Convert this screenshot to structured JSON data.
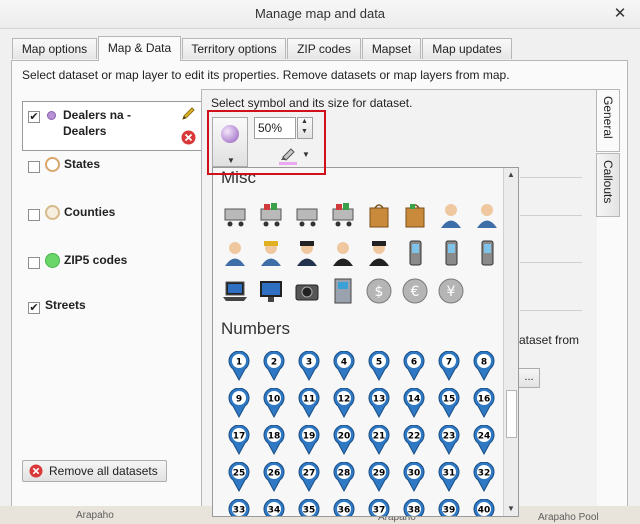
{
  "window": {
    "title": "Manage map and data"
  },
  "tabs": [
    "Map options",
    "Map & Data",
    "Territory options",
    "ZIP codes",
    "Mapset",
    "Map updates"
  ],
  "active_tab": "Map & Data",
  "instruction": "Select dataset or map layer to edit its properties. Remove datasets or map layers from map.",
  "datasets": [
    {
      "label_line1": "Dealers na -",
      "label_line2": "Dealers",
      "checked": true,
      "color": "#b992d6"
    },
    {
      "label": "States",
      "checked": false,
      "color": "#d8a56a"
    },
    {
      "label": "Counties",
      "checked": false,
      "color": "#d8b98a"
    },
    {
      "label": "ZIP5 codes",
      "checked": false,
      "color": "#6ad66a"
    },
    {
      "label": "Streets",
      "checked": true
    }
  ],
  "remove_all_label": "Remove all datasets",
  "properties": {
    "symbol_prompt": "Select symbol and its size for dataset.",
    "size_value": "50%",
    "partial_text": "ataset from",
    "browse_label": "..."
  },
  "side_tabs": [
    "General",
    "Callouts"
  ],
  "symbol_popup": {
    "sections": [
      {
        "title": "Misc",
        "icons": [
          "shopping-cart-icon",
          "shopping-cart-full-icon",
          "shopping-cart-empty-icon",
          "shopping-cart-gifts-icon",
          "shopping-bag-icon",
          "shopping-bag-gifts-icon",
          "businessman-icon",
          "businessman-2-icon",
          "user-icon",
          "worker-icon",
          "police-officer-icon",
          "agent-icon",
          "spy-icon",
          "mobile-phone-icon",
          "flip-phone-icon",
          "smartphone-icon",
          "laptop-icon",
          "desktop-computer-icon",
          "camera-icon",
          "atm-icon",
          "dollar-coin-icon",
          "euro-coin-icon",
          "yen-coin-icon"
        ]
      },
      {
        "title": "Numbers",
        "numbers": [
          "1",
          "2",
          "3",
          "4",
          "5",
          "6",
          "7",
          "8",
          "9",
          "10",
          "11",
          "12",
          "13",
          "14",
          "15",
          "16",
          "17",
          "18",
          "19",
          "20",
          "21",
          "22",
          "23",
          "24",
          "25",
          "26",
          "27",
          "28",
          "29",
          "30",
          "31",
          "32",
          "33",
          "34",
          "35",
          "36",
          "37",
          "38",
          "39",
          "40"
        ]
      }
    ]
  },
  "map_labels": [
    "Arapaho",
    "Arapaho",
    "Arapaho Pool"
  ]
}
